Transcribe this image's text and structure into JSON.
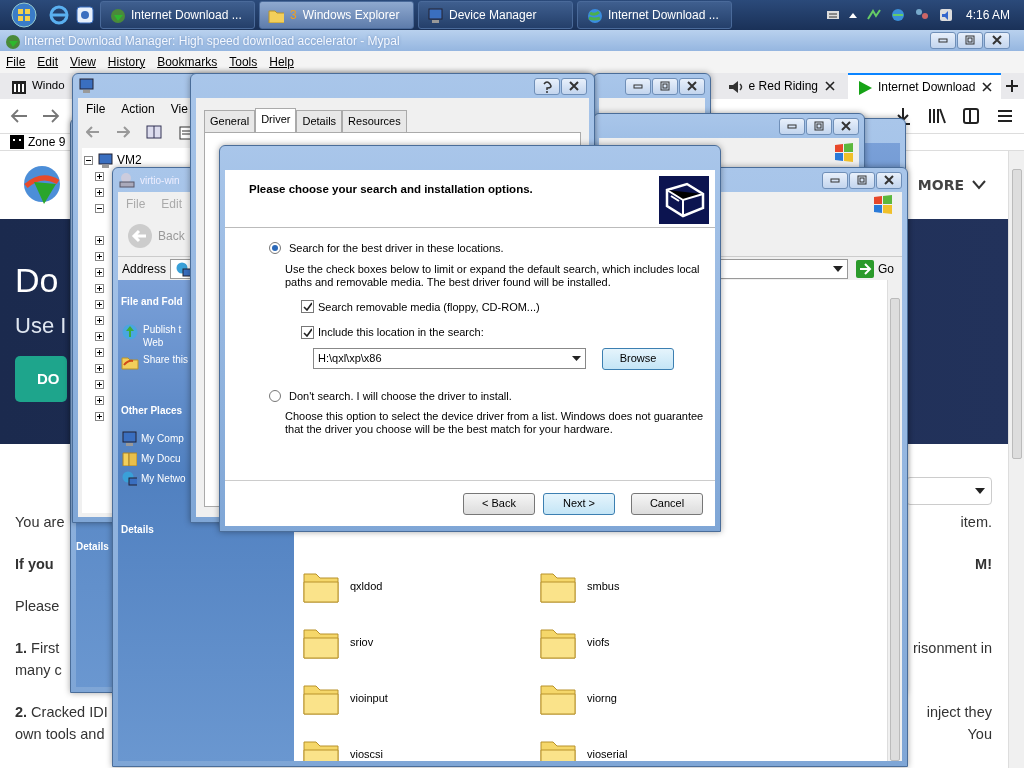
{
  "taskbar": {
    "apps": [
      {
        "label": "Internet Download ...",
        "selected": false,
        "kind": "idm"
      },
      {
        "label": "Windows Explorer",
        "count": "3",
        "selected": true,
        "kind": "folder"
      },
      {
        "label": "Device Manager",
        "selected": false,
        "kind": "computer"
      },
      {
        "label": "Internet Download ...",
        "selected": false,
        "kind": "globe"
      }
    ],
    "clock": "4:16 AM"
  },
  "browser": {
    "title": "Internet Download Manager: High speed download accelerator - Mypal",
    "menu": [
      "File",
      "Edit",
      "View",
      "History",
      "Bookmarks",
      "Tools",
      "Help"
    ],
    "tabs": [
      {
        "label": "Windo",
        "selected": false,
        "kind": "library"
      },
      {
        "label": "e Red Riding",
        "selected": false,
        "kind": "audio"
      },
      {
        "label": "Internet Download",
        "selected": true,
        "kind": "play"
      }
    ],
    "bookmarks": [
      "Zone 9"
    ],
    "page": {
      "more": "MORE",
      "hero_heading": "Do",
      "hero_sub": "Use I",
      "hero_button": "DO",
      "paragraphs": [
        {
          "bold": false,
          "lines": [
            {
              "left": "You are",
              "right": "item."
            }
          ]
        },
        {
          "bold": true,
          "lines": [
            {
              "left": "If you",
              "right": "M!"
            }
          ]
        },
        {
          "bold": false,
          "lines": [
            {
              "left": "Please"
            }
          ]
        },
        {
          "bold": false,
          "lines": [
            {
              "left": "**1.** First",
              "right": "risonment in"
            },
            {
              "left": "many c"
            }
          ]
        },
        {
          "bold": false,
          "lines": [
            {
              "left": "**2.** Cracked IDI",
              "right": "inject they"
            },
            {
              "left": "own tools and",
              "right": "You"
            }
          ]
        }
      ]
    }
  },
  "explorer_back": {
    "details": "Details"
  },
  "device_manager": {
    "menu": [
      "File",
      "Action",
      "Vie"
    ],
    "root": "VM2",
    "root_expanded": true,
    "nodes": [
      {
        "expanded": false
      },
      {
        "expanded": false
      },
      {
        "expanded": true
      },
      {
        "expanded": false
      },
      {
        "expanded": false
      },
      {
        "expanded": false
      },
      {
        "expanded": false
      },
      {
        "expanded": false
      },
      {
        "expanded": false
      },
      {
        "expanded": false
      },
      {
        "expanded": false
      },
      {
        "expanded": false
      },
      {
        "expanded": false
      },
      {
        "expanded": false
      },
      {
        "expanded": false
      }
    ]
  },
  "explorer": {
    "title": "virtio-win",
    "menu": [
      "File",
      "Edit"
    ],
    "back": "Back",
    "address_label": "Address",
    "go": "Go",
    "tasks_heading": "File and Fold",
    "tasks": [
      {
        "label": "Publish t\nWeb",
        "kind": "publish"
      },
      {
        "label": "Share this",
        "kind": "share"
      }
    ],
    "places_heading": "Other Places",
    "places": [
      {
        "label": "My Comp",
        "kind": "computer"
      },
      {
        "label": "My Docu",
        "kind": "documents"
      },
      {
        "label": "My Netwo",
        "kind": "network"
      }
    ],
    "details": "Details",
    "folders": [
      "qxldod",
      "smbus",
      "sriov",
      "viofs",
      "vioinput",
      "viorng",
      "vioscsi",
      "vioserial"
    ]
  },
  "properties": {
    "tabs": [
      {
        "label": "General",
        "selected": false
      },
      {
        "label": "Driver",
        "selected": true
      },
      {
        "label": "Details",
        "selected": false
      },
      {
        "label": "Resources",
        "selected": false
      }
    ]
  },
  "wizard": {
    "heading": "Please choose your search and installation options.",
    "options": [
      {
        "label": "Search for the best driver in these locations.",
        "selected": true,
        "description": "Use the check boxes below to limit or expand the default search, which includes local paths and removable media. The best driver found will be installed."
      },
      {
        "label": "Don't search. I will choose the driver to install.",
        "selected": false,
        "description": "Choose this option to select the device driver from a list.  Windows does not guarantee that the driver you choose will be the best match for your hardware."
      }
    ],
    "checkboxes": [
      {
        "label": "Search removable media (floppy, CD-ROM...)",
        "checked": true
      },
      {
        "label": "Include this location in the search:",
        "checked": true
      }
    ],
    "location": "H:\\qxl\\xp\\x86",
    "browse": "Browse",
    "buttons": [
      {
        "label": "< Back",
        "focused": false
      },
      {
        "label": "Next >",
        "focused": true
      },
      {
        "label": "Cancel",
        "focused": false
      }
    ]
  }
}
